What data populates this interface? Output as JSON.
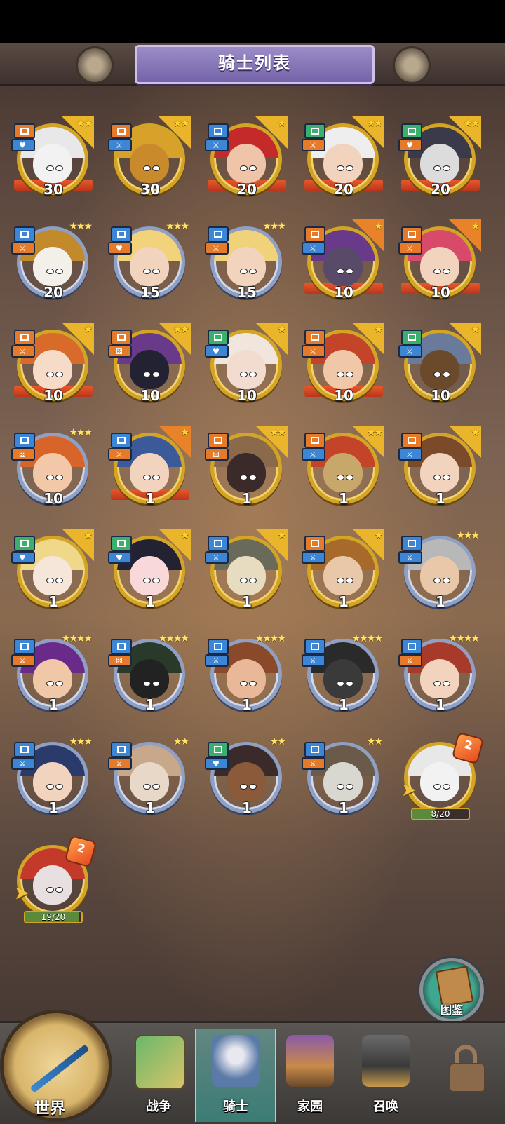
{
  "header": {
    "title": "骑士列表"
  },
  "knights": [
    {
      "level": "30",
      "stars": "★★",
      "ribbon": true,
      "silver": false,
      "flag": "gold",
      "b1": "b-orange",
      "b2": "b-blue",
      "b2icon": "♥",
      "hair": "#e8e8e8",
      "skin": "#f2f2f2"
    },
    {
      "level": "30",
      "stars": "★★",
      "ribbon": false,
      "silver": false,
      "flag": "gold",
      "b1": "b-orange",
      "b2": "b-blue",
      "b2icon": "⚔",
      "hair": "#d8a22a",
      "skin": "#c88a2a"
    },
    {
      "level": "20",
      "stars": "★",
      "ribbon": true,
      "silver": false,
      "flag": "gold",
      "b1": "b-blue",
      "b2": "b-blue",
      "b2icon": "⚔",
      "hair": "#c42a2a",
      "skin": "#f0c4a8"
    },
    {
      "level": "20",
      "stars": "★★",
      "ribbon": true,
      "silver": false,
      "flag": "gold",
      "b1": "b-green",
      "b2": "b-orange",
      "b2icon": "⚔",
      "hair": "#eeeeee",
      "skin": "#f2d4be"
    },
    {
      "level": "20",
      "stars": "★★",
      "ribbon": true,
      "silver": false,
      "flag": "gold",
      "b1": "b-green",
      "b2": "b-orange",
      "b2icon": "♥",
      "hair": "#3a3a4a",
      "skin": "#dcdcdc"
    },
    {
      "level": "20",
      "stars": "★★★",
      "ribbon": false,
      "silver": true,
      "flag": "none",
      "b1": "b-blue",
      "b2": "b-orange",
      "b2icon": "⚔",
      "hair": "#c28a2a",
      "skin": "#f3f0ea"
    },
    {
      "level": "15",
      "stars": "★★★",
      "ribbon": false,
      "silver": true,
      "flag": "none",
      "b1": "b-blue",
      "b2": "b-orange",
      "b2icon": "♥",
      "hair": "#f2d27a",
      "skin": "#f2d4be"
    },
    {
      "level": "15",
      "stars": "★★★",
      "ribbon": false,
      "silver": true,
      "flag": "none",
      "b1": "b-blue",
      "b2": "b-orange",
      "b2icon": "⚔",
      "hair": "#f0d27a",
      "skin": "#f2d4be"
    },
    {
      "level": "10",
      "stars": "★",
      "ribbon": true,
      "silver": false,
      "flag": "red",
      "b1": "b-orange",
      "b2": "b-blue",
      "b2icon": "⚔",
      "hair": "#6a3a8a",
      "skin": "#5a4a6a"
    },
    {
      "level": "10",
      "stars": "★",
      "ribbon": true,
      "silver": false,
      "flag": "red",
      "b1": "b-orange",
      "b2": "b-orange",
      "b2icon": "⚔",
      "hair": "#d84a6a",
      "skin": "#f2d4be"
    },
    {
      "level": "10",
      "stars": "★",
      "ribbon": true,
      "silver": false,
      "flag": "gold",
      "b1": "b-orange",
      "b2": "b-orange",
      "b2icon": "⚔",
      "hair": "#d86a2a",
      "skin": "#f6dcc8"
    },
    {
      "level": "10",
      "stars": "★★",
      "ribbon": false,
      "silver": false,
      "flag": "gold",
      "b1": "b-orange",
      "b2": "b-orange",
      "b2icon": "⚄",
      "hair": "#6a3a8a",
      "skin": "#222233"
    },
    {
      "level": "10",
      "stars": "★",
      "ribbon": false,
      "silver": false,
      "flag": "gold",
      "b1": "b-green",
      "b2": "b-blue",
      "b2icon": "♥",
      "hair": "#f0e6de",
      "skin": "#f2dcd0"
    },
    {
      "level": "10",
      "stars": "★",
      "ribbon": true,
      "silver": false,
      "flag": "gold",
      "b1": "b-orange",
      "b2": "b-orange",
      "b2icon": "⚔",
      "hair": "#c4442a",
      "skin": "#f0c8a8"
    },
    {
      "level": "10",
      "stars": "★",
      "ribbon": false,
      "silver": false,
      "flag": "gold",
      "b1": "b-green",
      "b2": "b-blue",
      "b2icon": "⚔",
      "hair": "#6a7a9a",
      "skin": "#6a4a2a"
    },
    {
      "level": "10",
      "stars": "★★★",
      "ribbon": false,
      "silver": true,
      "flag": "none",
      "b1": "b-blue",
      "b2": "b-orange",
      "b2icon": "⚄",
      "hair": "#d8642a",
      "skin": "#f2c8a8"
    },
    {
      "level": "1",
      "stars": "★",
      "ribbon": true,
      "silver": false,
      "flag": "red",
      "b1": "b-blue",
      "b2": "b-orange",
      "b2icon": "⚔",
      "hair": "#3a5a9a",
      "skin": "#f2d4be"
    },
    {
      "level": "1",
      "stars": "★★",
      "ribbon": false,
      "silver": false,
      "flag": "gold",
      "b1": "b-orange",
      "b2": "b-orange",
      "b2icon": "⚄",
      "hair": "#8a6a4a",
      "skin": "#3a2a2a"
    },
    {
      "level": "1",
      "stars": "★★",
      "ribbon": false,
      "silver": false,
      "flag": "gold",
      "b1": "b-orange",
      "b2": "b-blue",
      "b2icon": "⚔",
      "hair": "#c4442a",
      "skin": "#c8a86a"
    },
    {
      "level": "1",
      "stars": "★",
      "ribbon": false,
      "silver": false,
      "flag": "gold",
      "b1": "b-orange",
      "b2": "b-blue",
      "b2icon": "⚔",
      "hair": "#7a4a2a",
      "skin": "#f2d4be"
    },
    {
      "level": "1",
      "stars": "★",
      "ribbon": false,
      "silver": false,
      "flag": "gold",
      "b1": "b-green",
      "b2": "b-blue",
      "b2icon": "♥",
      "hair": "#f0d88a",
      "skin": "#f6e6da"
    },
    {
      "level": "1",
      "stars": "★",
      "ribbon": false,
      "silver": false,
      "flag": "gold",
      "b1": "b-green",
      "b2": "b-blue",
      "b2icon": "♥",
      "hair": "#222233",
      "skin": "#f8d8d8"
    },
    {
      "level": "1",
      "stars": "★",
      "ribbon": false,
      "silver": false,
      "flag": "gold",
      "b1": "b-blue",
      "b2": "b-blue",
      "b2icon": "⚔",
      "hair": "#6a6a5a",
      "skin": "#e8dcc0"
    },
    {
      "level": "1",
      "stars": "★",
      "ribbon": false,
      "silver": false,
      "flag": "gold",
      "b1": "b-orange",
      "b2": "b-blue",
      "b2icon": "⚔",
      "hair": "#a86a2a",
      "skin": "#e8c8a8"
    },
    {
      "level": "1",
      "stars": "★★★",
      "ribbon": false,
      "silver": true,
      "flag": "none",
      "b1": "b-blue",
      "b2": "b-blue",
      "b2icon": "⚔",
      "hair": "#b8b8b8",
      "skin": "#e8c8a8"
    },
    {
      "level": "1",
      "stars": "★★★★",
      "ribbon": false,
      "silver": true,
      "flag": "none",
      "b1": "b-blue",
      "b2": "b-orange",
      "b2icon": "⚔",
      "hair": "#6a2a8a",
      "skin": "#f0c8a8"
    },
    {
      "level": "1",
      "stars": "★★★★",
      "ribbon": false,
      "silver": true,
      "flag": "none",
      "b1": "b-blue",
      "b2": "b-orange",
      "b2icon": "⚄",
      "hair": "#2a3a2a",
      "skin": "#222222"
    },
    {
      "level": "1",
      "stars": "★★★★",
      "ribbon": false,
      "silver": true,
      "flag": "none",
      "b1": "b-blue",
      "b2": "b-blue",
      "b2icon": "⚔",
      "hair": "#8a4a2a",
      "skin": "#e8b898"
    },
    {
      "level": "1",
      "stars": "★★★★",
      "ribbon": false,
      "silver": true,
      "flag": "none",
      "b1": "b-blue",
      "b2": "b-blue",
      "b2icon": "⚔",
      "hair": "#2a2a2a",
      "skin": "#3a3a3a"
    },
    {
      "level": "1",
      "stars": "★★★★",
      "ribbon": false,
      "silver": true,
      "flag": "none",
      "b1": "b-blue",
      "b2": "b-orange",
      "b2icon": "⚔",
      "hair": "#a83a2a",
      "skin": "#f2d4be"
    },
    {
      "level": "1",
      "stars": "★★★",
      "ribbon": false,
      "silver": true,
      "flag": "none",
      "b1": "b-blue",
      "b2": "b-blue",
      "b2icon": "⚔",
      "hair": "#2a3a6a",
      "skin": "#f2d4be"
    },
    {
      "level": "1",
      "stars": "★★",
      "ribbon": false,
      "silver": true,
      "flag": "none",
      "b1": "b-blue",
      "b2": "b-orange",
      "b2icon": "⚔",
      "hair": "#c8a88a",
      "skin": "#e8d8c8"
    },
    {
      "level": "1",
      "stars": "★★",
      "ribbon": false,
      "silver": true,
      "flag": "none",
      "b1": "b-green",
      "b2": "b-blue",
      "b2icon": "♥",
      "hair": "#3a2a2a",
      "skin": "#8a5a3a"
    },
    {
      "level": "1",
      "stars": "★★",
      "ribbon": false,
      "silver": true,
      "flag": "none",
      "b1": "b-blue",
      "b2": "b-orange",
      "b2icon": "⚔",
      "hair": "#6a5a4a",
      "skin": "#d8d8d0"
    }
  ],
  "shards": [
    {
      "progress": "8/20",
      "fraction": 0.4,
      "hair": "#e8e8e8",
      "skin": "#f2f2f2"
    },
    {
      "progress": "19/20",
      "fraction": 0.95,
      "hair": "#c43a2a",
      "skin": "#e8e0e0"
    }
  ],
  "atlas": {
    "label": "图鉴"
  },
  "nav": {
    "world": "世界",
    "war": "战争",
    "knight": "骑士",
    "home": "家园",
    "summon": "召唤"
  }
}
